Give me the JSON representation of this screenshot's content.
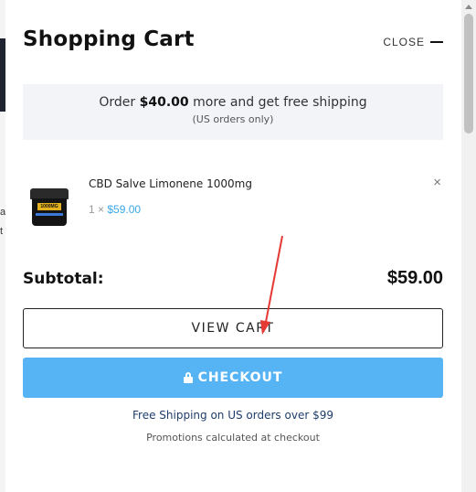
{
  "cart": {
    "title": "Shopping Cart",
    "close_label": "CLOSE",
    "notice": {
      "prefix": "Order ",
      "amount": "$40.00",
      "suffix": " more and get free shipping",
      "note": "(US orders only)"
    },
    "items": [
      {
        "name": "CBD Salve Limonene 1000mg",
        "quantity": "1 ×",
        "price": "$59.00",
        "thumb_label": "1000MG"
      }
    ],
    "remove_glyph": "×",
    "subtotal_label": "Subtotal:",
    "subtotal_value": "$59.00",
    "view_cart_label": "VIEW CART",
    "checkout_label": "CHECKOUT",
    "free_shipping_text": "Free Shipping on US orders over $99",
    "promo_text": "Promotions calculated at checkout"
  },
  "background": {
    "letter_a": "a",
    "letter_t": "t"
  },
  "colors": {
    "accent": "#56b4f5",
    "price": "#3aa7e8",
    "annotation_arrow": "#e53935"
  },
  "icons": [
    "close-line-icon",
    "remove-icon",
    "lock-icon",
    "annotation-arrow"
  ]
}
